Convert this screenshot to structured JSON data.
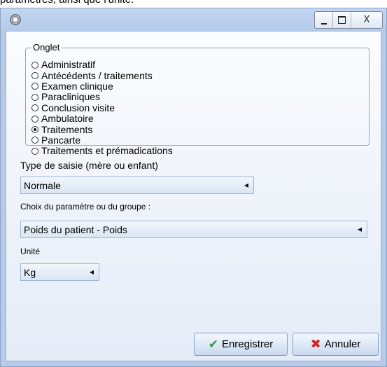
{
  "caption_above": "paramètres, ainsi que l'unité.",
  "window": {
    "controls": {
      "minimize": "–",
      "maximize": "□",
      "close": "X"
    }
  },
  "onglet": {
    "legend": "Onglet",
    "options": [
      {
        "label": "Administratif",
        "checked": false
      },
      {
        "label": "Antécédents / traitements",
        "checked": false
      },
      {
        "label": "Examen clinique",
        "checked": false
      },
      {
        "label": "Paracliniques",
        "checked": false
      },
      {
        "label": "Conclusion visite",
        "checked": false
      },
      {
        "label": "Ambulatoire",
        "checked": false
      },
      {
        "label": "Traitements",
        "checked": true
      },
      {
        "label": "Pancarte",
        "checked": false
      },
      {
        "label": "Traitements et prémadications",
        "checked": false
      }
    ]
  },
  "type_saisie": {
    "label": "Type de saisie (mère ou enfant)",
    "value": "Normale"
  },
  "parametre": {
    "label": "Choix du paramètre ou du groupe :",
    "value": "Poids du patient - Poids"
  },
  "unite": {
    "label": "Unité",
    "value": "Kg"
  },
  "buttons": {
    "save": "Enregistrer",
    "cancel": "Annuler"
  },
  "icons": {
    "app": "gear-icon",
    "save": "check-icon",
    "cancel": "cross-icon",
    "dropdown": "dropdown-arrow-icon"
  },
  "colors": {
    "window_frame": "#b6cbeb",
    "check_green": "#2e9b36",
    "cross_red": "#d4231f"
  }
}
